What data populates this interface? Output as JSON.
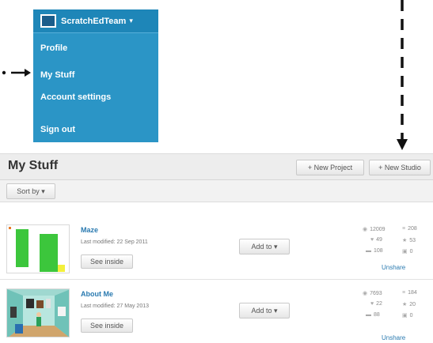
{
  "account_menu": {
    "username": "ScratchEdTeam",
    "caret": "▾",
    "items": [
      "Profile",
      "My Stuff",
      "Account settings",
      "Sign out"
    ]
  },
  "header": {
    "title": "My Stuff",
    "new_project": "+ New Project",
    "new_studio": "+ New Studio"
  },
  "filter": {
    "sort_label": "Sort by ▾"
  },
  "projects": [
    {
      "title": "Maze",
      "last_modified": "Last modified: 22 Sep 2011",
      "see_inside": "See inside",
      "add_to": "Add to ▾",
      "views": "12009",
      "loves": "49",
      "comments": "108",
      "remixes": "208",
      "favorites": "53",
      "studios": "0",
      "unshare": "Unshare"
    },
    {
      "title": "About Me",
      "last_modified": "Last modified: 27 May 2013",
      "see_inside": "See inside",
      "add_to": "Add to ▾",
      "views": "7693",
      "loves": "22",
      "comments": "88",
      "remixes": "184",
      "favorites": "20",
      "studios": "0",
      "unshare": "Unshare"
    }
  ],
  "icons": {
    "views": "eye-icon",
    "loves": "heart-icon",
    "comments": "comment-icon",
    "remixes": "remix-icon",
    "favorites": "star-icon",
    "studios": "studio-icon"
  },
  "colors": {
    "menu_bg": "#2b95c6",
    "link": "#2a7ab0",
    "header_bg": "#ededed"
  }
}
